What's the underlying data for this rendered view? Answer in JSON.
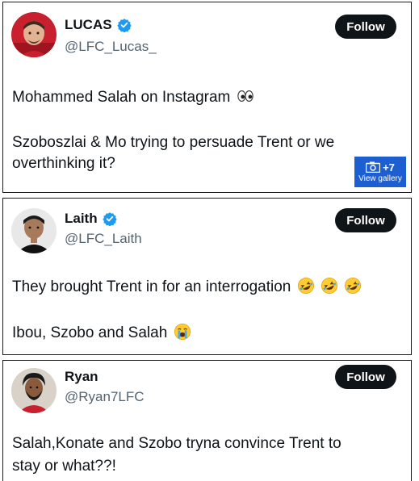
{
  "tweets": [
    {
      "display_name": "LUCAS",
      "handle": "@LFC_Lucas_",
      "follow_label": "Follow",
      "verified": true,
      "text_lines": [
        "Mohammed Salah on Instagram",
        "Szoboszlai & Mo trying to persuade Trent or we",
        "overthinking it?"
      ],
      "emoji_line_1": "eyes-emoji",
      "gallery": {
        "count_label": "+7",
        "label": "View gallery"
      }
    },
    {
      "display_name": "Laith",
      "handle": "@LFC_Laith",
      "follow_label": "Follow",
      "verified": true,
      "text_lines": [
        "They brought Trent in for an interrogation",
        "Ibou, Szobo and Salah"
      ],
      "emoji_line_1": "rolling-on-floor-laughing-emoji x3",
      "emoji_line_2": "loudly-crying-emoji"
    },
    {
      "display_name": "Ryan",
      "handle": "@Ryan7LFC",
      "follow_label": "Follow",
      "verified": false,
      "text_lines": [
        "Salah,Konate and Szobo tryna convince Trent to",
        "stay or what??!"
      ]
    }
  ],
  "colors": {
    "text": "#0f1419",
    "handle": "#536471",
    "follow_bg": "#0f1419",
    "verified_blue": "#1d9bf0",
    "gallery_blue": "#1d5fd1"
  }
}
